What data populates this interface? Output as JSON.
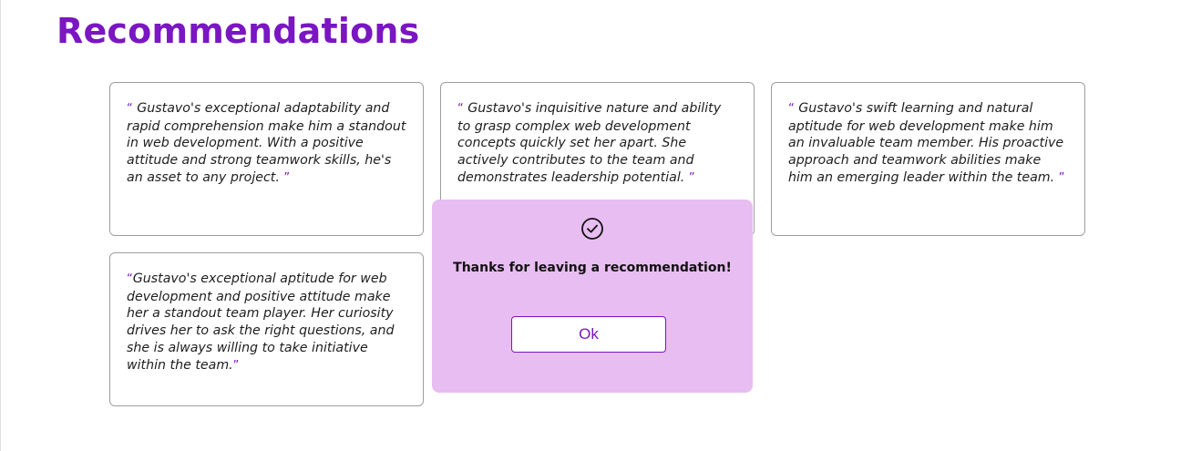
{
  "page": {
    "title": "Recommendations"
  },
  "recommendations": [
    {
      "open_quote": "“",
      "text": " Gustavo's exceptional adaptability and rapid comprehension make him a standout in web development. With a positive attitude and strong teamwork skills, he's an asset to any project. ",
      "close_quote": "”"
    },
    {
      "open_quote": "“",
      "text": " Gustavo's inquisitive nature and ability to grasp complex web development concepts quickly set her apart. She actively contributes to the team and demonstrates leadership potential. ",
      "close_quote": "”"
    },
    {
      "open_quote": "“",
      "text": " Gustavo's swift learning and natural aptitude for web development make him an invaluable team member. His proactive approach and teamwork abilities make him an emerging leader within the team. ",
      "close_quote": "”"
    },
    {
      "open_quote": "“",
      "text": "Gustavo's exceptional aptitude for web development and positive attitude make her a standout team player. Her curiosity drives her to ask the right questions, and she is always willing to take initiative within the team.",
      "close_quote": "”"
    }
  ],
  "modal": {
    "icon": "check-circle-icon",
    "message": "Thanks for leaving a recommendation!",
    "ok_label": "Ok"
  },
  "colors": {
    "accent": "#7a16c2",
    "modal_background": "#e8bdf1",
    "card_border": "#9e9e9e"
  }
}
